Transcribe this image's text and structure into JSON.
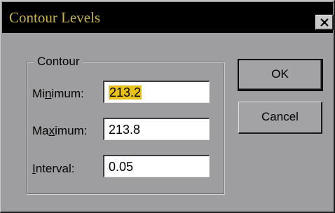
{
  "window": {
    "title": "Contour Levels",
    "close_glyph": "x"
  },
  "group": {
    "legend": "Contour"
  },
  "fields": [
    {
      "label_pre": "Mi",
      "label_key": "n",
      "label_post": "imum:",
      "value": "213.2",
      "selected": true
    },
    {
      "label_pre": "Ma",
      "label_key": "x",
      "label_post": "imum:",
      "value": "213.8",
      "selected": false
    },
    {
      "label_pre": "",
      "label_key": "I",
      "label_post": "nterval:",
      "value": "0.05",
      "selected": false
    }
  ],
  "buttons": {
    "ok_label": "OK",
    "cancel_label": "Cancel"
  },
  "colors": {
    "titlebar": "#000000",
    "title_text": "#c8b44a",
    "dialog_bg": "#9e9ea0",
    "selection_highlight": "#e8c21a"
  }
}
